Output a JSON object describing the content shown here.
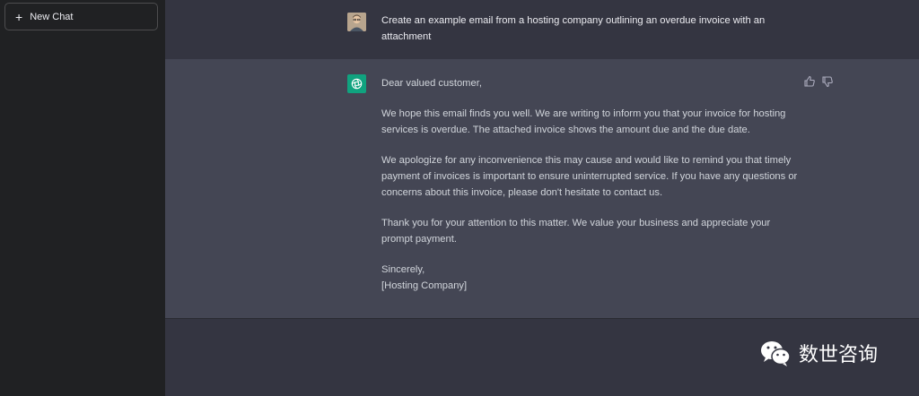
{
  "sidebar": {
    "new_chat_label": "New Chat"
  },
  "conversation": {
    "user_prompt": "Create an example email from a hosting company outlining an overdue invoice with an attachment",
    "assistant_paragraphs": [
      "Dear valued customer,",
      "We hope this email finds you well. We are writing to inform you that your invoice for hosting services is overdue. The attached invoice shows the amount due and the due date.",
      "We apologize for any inconvenience this may cause and would like to remind you that timely payment of invoices is important to ensure uninterrupted service. If you have any questions or concerns about this invoice, please don't hesitate to contact us.",
      "Thank you for your attention to this matter. We value your business and appreciate your prompt payment.",
      "Sincerely,",
      "[Hosting Company]"
    ]
  },
  "icons": {
    "new_chat": "plus-icon",
    "user_avatar": "user-avatar",
    "assistant_avatar": "openai-logo-icon",
    "thumbs_up": "thumbs-up-icon",
    "thumbs_down": "thumbs-down-icon",
    "watermark_logo": "wechat-icon"
  },
  "watermark": {
    "text": "数世咨询"
  },
  "colors": {
    "sidebar_bg": "#202123",
    "main_bg": "#343541",
    "assistant_bg": "#444654",
    "brand_green": "#10a37f"
  }
}
